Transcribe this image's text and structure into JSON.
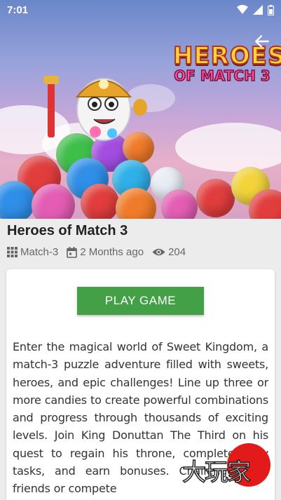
{
  "status_bar": {
    "time": "7:01"
  },
  "game": {
    "logo_line1": "HEROES",
    "logo_line2": "OF MATCH 3",
    "title": "Heroes of Match 3",
    "category": "Match-3",
    "posted": "2 Months ago",
    "views": "204",
    "play_label": "PLAY GAME",
    "description": "Enter the magical world of Sweet Kingdom, a match-3 puzzle adventure filled with sweets, heroes, and epic challenges! Line up three or more candies to create powerful combinations and progress through thousands of exciting levels. Join King Donuttan The Third on his quest to regain his throne, complete daily tasks, and earn bonuses. Challenge your friends or compete"
  },
  "watermark": {
    "text": "大玩家"
  },
  "colors": {
    "accent": "#43a047",
    "watermark": "#e21a1a"
  },
  "icons": [
    "wifi-icon",
    "signal-icon",
    "battery-icon",
    "back-arrow-icon",
    "grid-icon",
    "calendar-icon",
    "eye-icon"
  ]
}
